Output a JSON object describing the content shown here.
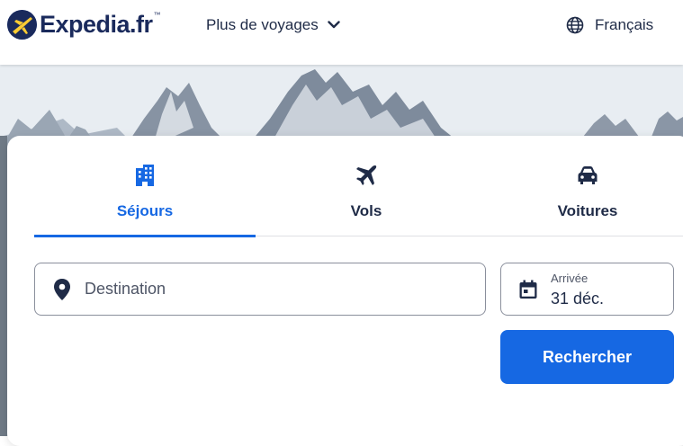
{
  "header": {
    "logo_text": "Expedia.fr",
    "logo_tm": "™",
    "nav_more_label": "Plus de voyages",
    "language_label": "Français"
  },
  "search": {
    "tabs": [
      {
        "label": "Séjours",
        "icon": "hotel-icon",
        "active": true
      },
      {
        "label": "Vols",
        "icon": "plane-icon",
        "active": false
      },
      {
        "label": "Voitures",
        "icon": "car-icon",
        "active": false
      }
    ],
    "destination_placeholder": "Destination",
    "date_label": "Arrivée",
    "date_value": "31 déc.",
    "search_button_label": "Rechercher"
  },
  "colors": {
    "accent": "#1668e3",
    "text": "#1f2b47",
    "logo_yellow": "#fbcc33",
    "logo_navy": "#1a2a5c"
  }
}
